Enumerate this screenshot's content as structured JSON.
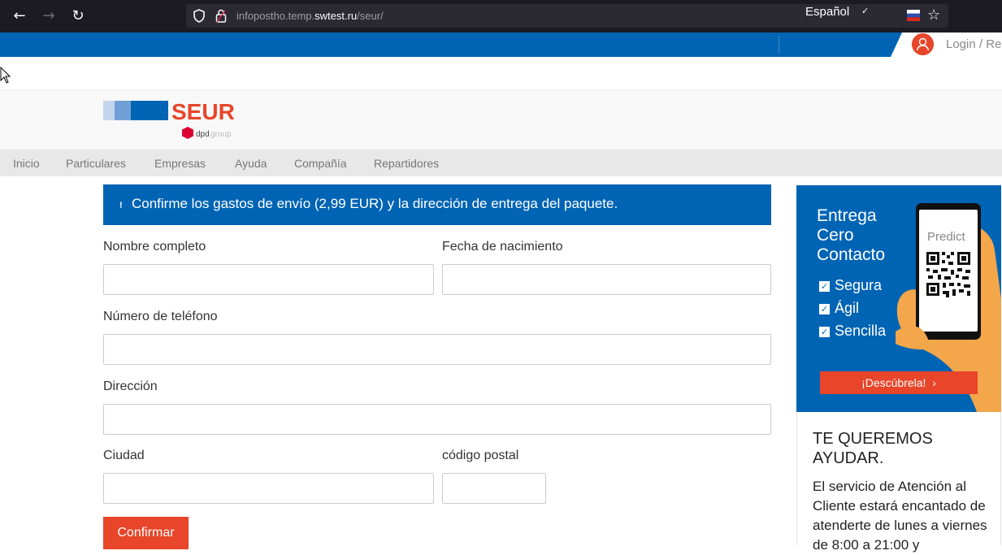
{
  "browser": {
    "url_prefix": "infopostho.temp.",
    "url_domain": "swtest.ru",
    "url_suffix": "/seur/"
  },
  "topbar": {
    "language": "Español",
    "login": "Login / Re"
  },
  "logo": {
    "brand": "SEUR",
    "sub_bold": "dpd",
    "sub_light": "group"
  },
  "menu": [
    "Inicio",
    "Particulares",
    "Empresas",
    "Ayuda",
    "Compañía",
    "Repartidores"
  ],
  "alert": {
    "icon": "!",
    "message": "Confirme los gastos de envío (2,99 EUR) y la dirección de entrega del paquete."
  },
  "form": {
    "name_label": "Nombre completo",
    "birth_label": "Fecha de nacimiento",
    "phone_label": "Número de teléfono",
    "address_label": "Dirección",
    "city_label": "Ciudad",
    "postal_label": "código postal",
    "submit": "Confirmar",
    "name_value": "",
    "birth_value": "",
    "phone_value": "",
    "address_value": "",
    "city_value": "",
    "postal_value": ""
  },
  "promo": {
    "title_1": "Entrega",
    "title_2": "Cero",
    "title_3": "Contacto",
    "checks": [
      "Segura",
      "Ágil",
      "Sencilla"
    ],
    "phone_label": "Predict",
    "button": "¡Descúbrela!"
  },
  "help": {
    "title": "TE QUEREMOS AYUDAR.",
    "text": "El servicio de Atención al Cliente estará encantado de atenderte de lunes a viernes de 8:00 a 21:00 y"
  },
  "colors": {
    "brand_blue": "#0064b4",
    "brand_red": "#e8452a"
  }
}
